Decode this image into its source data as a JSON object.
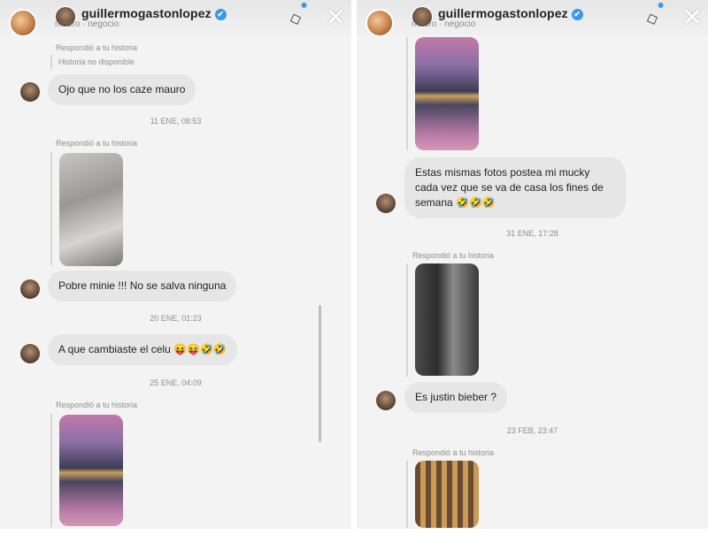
{
  "header": {
    "username": "guillermogastonlopez",
    "verified_mark": "✔",
    "subtitle": "mauro · negocio",
    "close_symbol": "✕",
    "sticker_symbol": "◇"
  },
  "left": {
    "reply_label": "Respondió a tu historia",
    "unavailable": "Historia no disponible",
    "msg1": "Ojo que no los caze mauro",
    "time1": "11 ENE, 08:53",
    "reply_label2": "Respondió a tu historia",
    "msg2": "Pobre minie !!! No se salva ninguna",
    "time2": "20 ENE, 01:23",
    "msg3_text": "A que cambiaste el celu",
    "msg3_emojis": "😝😝🤣🤣",
    "time3": "25 ENE, 04:09",
    "reply_label3": "Respondió a tu historia"
  },
  "right": {
    "msg1_text": "Estas mismas fotos postea mi mucky cada vez que se va de casa los fines de semana",
    "msg1_emojis": "🤣🤣🤣",
    "time1": "31 ENE, 17:28",
    "reply_label1": "Respondió a tu historia",
    "msg2": "Es justin bieber ?",
    "time2": "23 FEB, 23:47",
    "reply_label2": "Respondió a tu historia"
  }
}
